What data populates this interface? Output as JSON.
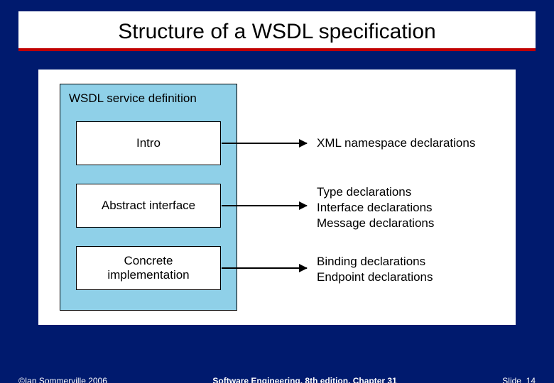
{
  "slide": {
    "title": "Structure of a WSDL specification"
  },
  "diagram": {
    "container_label": "WSDL service definition",
    "boxes": {
      "intro": "Intro",
      "abstract": "Abstract interface",
      "concrete": "Concrete\nimplementation"
    },
    "descriptions": {
      "intro": "XML namespace declarations",
      "abstract": "Type declarations\nInterface declarations\nMessage declarations",
      "concrete": "Binding declarations\nEndpoint declarations"
    }
  },
  "footer": {
    "copyright": "©Ian Sommerville 2006",
    "center": "Software Engineering, 8th edition. Chapter 31",
    "slide_label": "Slide",
    "slide_number": "14"
  }
}
